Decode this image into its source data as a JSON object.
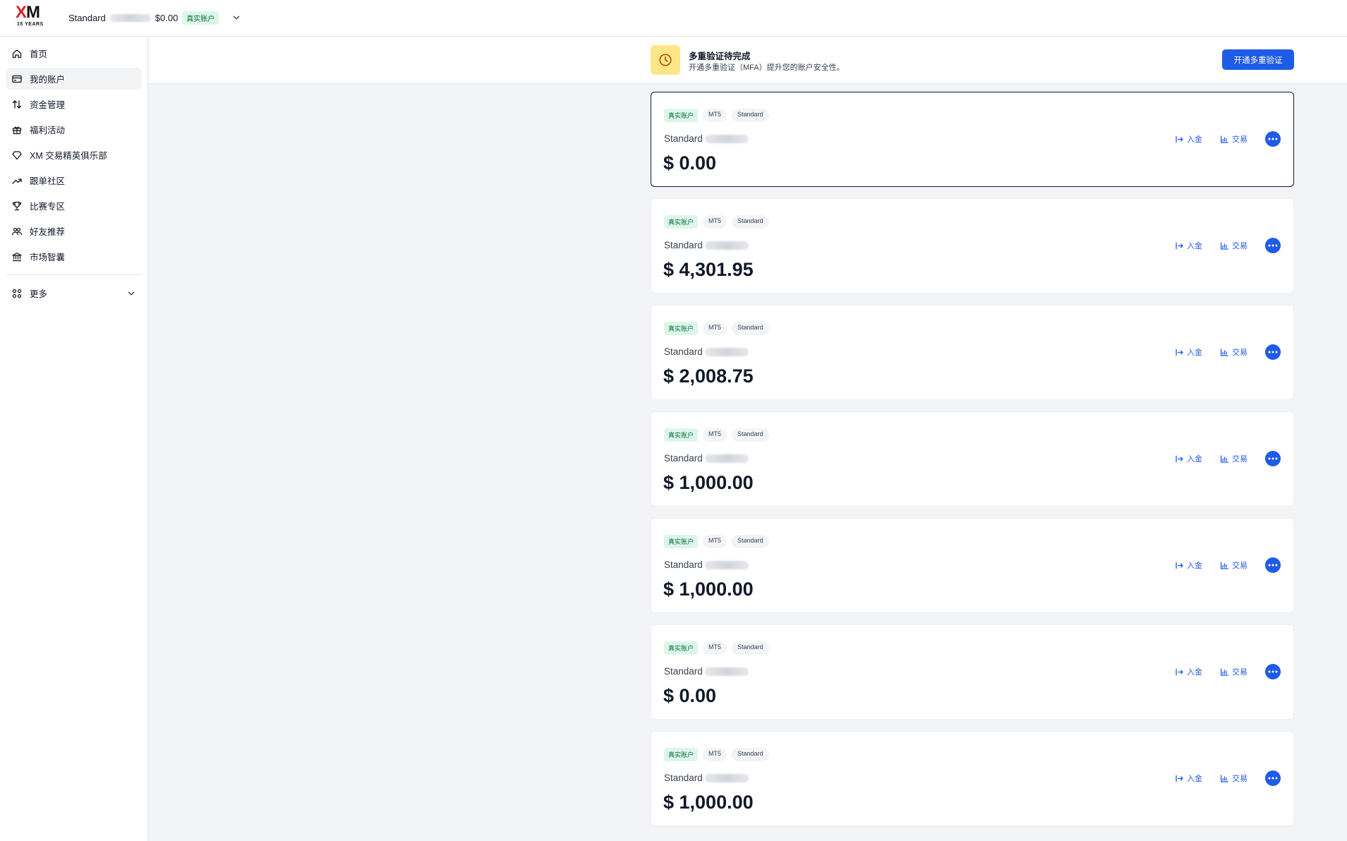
{
  "topbar": {
    "account_type": "Standard",
    "account_balance": "$0.00",
    "account_badge": "真实账户"
  },
  "sidebar": {
    "items": [
      {
        "label": "首页",
        "icon": "home-icon"
      },
      {
        "label": "我的账户",
        "icon": "card-icon"
      },
      {
        "label": "资金管理",
        "icon": "transfer-icon"
      },
      {
        "label": "福利活动",
        "icon": "gift-icon"
      },
      {
        "label": "XM 交易精英俱乐部",
        "icon": "diamond-icon"
      },
      {
        "label": "跟单社区",
        "icon": "trend-icon"
      },
      {
        "label": "比赛专区",
        "icon": "trophy-icon"
      },
      {
        "label": "好友推荐",
        "icon": "friends-icon"
      },
      {
        "label": "市场智囊",
        "icon": "bank-icon"
      }
    ],
    "active_index": 1,
    "more_label": "更多"
  },
  "mfa": {
    "title": "多重验证待完成",
    "description": "开通多重验证（MFA）提升您的账户安全性。",
    "button_label": "开通多重验证"
  },
  "accounts": [
    {
      "tags": [
        "真实账户",
        "MT5",
        "Standard"
      ],
      "name": "Standard",
      "balance": "$ 0.00"
    },
    {
      "tags": [
        "真实账户",
        "MT5",
        "Standard"
      ],
      "name": "Standard",
      "balance": "$ 4,301.95"
    },
    {
      "tags": [
        "真实账户",
        "MT5",
        "Standard"
      ],
      "name": "Standard",
      "balance": "$ 2,008.75"
    },
    {
      "tags": [
        "真实账户",
        "MT5",
        "Standard"
      ],
      "name": "Standard",
      "balance": "$ 1,000.00"
    },
    {
      "tags": [
        "真实账户",
        "MT5",
        "Standard"
      ],
      "name": "Standard",
      "balance": "$ 1,000.00"
    },
    {
      "tags": [
        "真实账户",
        "MT5",
        "Standard"
      ],
      "name": "Standard",
      "balance": "$ 0.00"
    },
    {
      "tags": [
        "真实账户",
        "MT5",
        "Standard"
      ],
      "name": "Standard",
      "balance": "$ 1,000.00"
    }
  ],
  "card_actions": {
    "deposit_label": "入金",
    "trade_label": "交易"
  },
  "colors": {
    "accent": "#1e5be6",
    "badge_bg": "#dcf7ea",
    "badge_text": "#0b6b3a",
    "mfa_icon_bg": "#fde68a"
  }
}
